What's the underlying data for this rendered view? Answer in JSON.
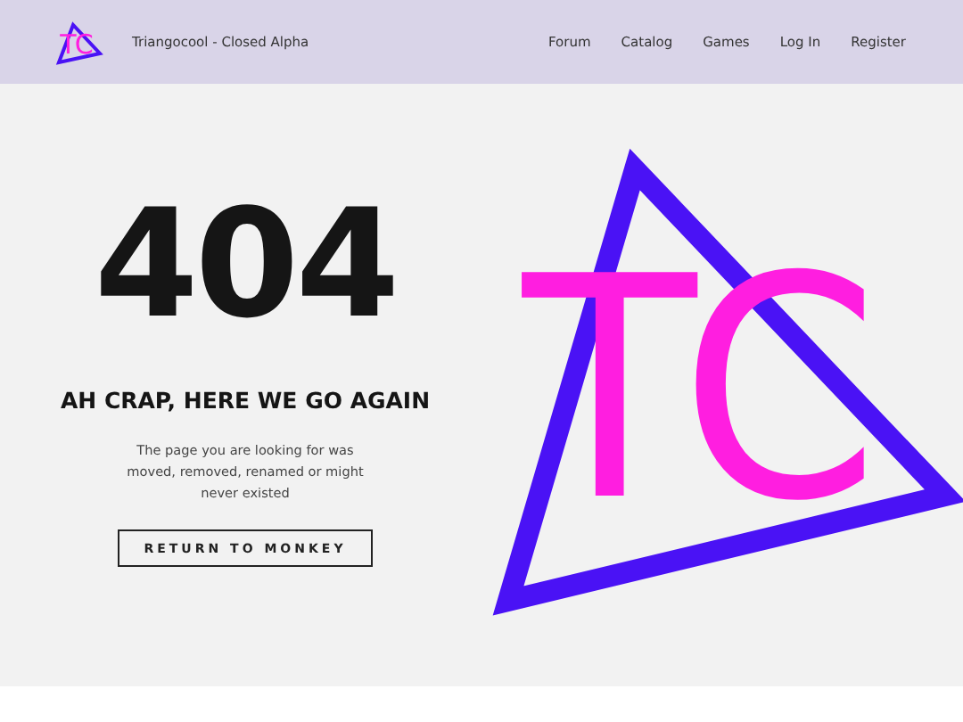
{
  "navbar": {
    "logo_text": "TC",
    "brand": "Triangocool - Closed Alpha",
    "links": [
      "Forum",
      "Catalog",
      "Games",
      "Log In",
      "Register"
    ]
  },
  "error": {
    "code": "404",
    "heading": "AH CRAP, HERE WE GO AGAIN",
    "message": "The page you are looking for was moved, removed, renamed or might never existed",
    "button": "RETURN TO MONKEY"
  },
  "hero_logo": {
    "text": "TC"
  }
}
